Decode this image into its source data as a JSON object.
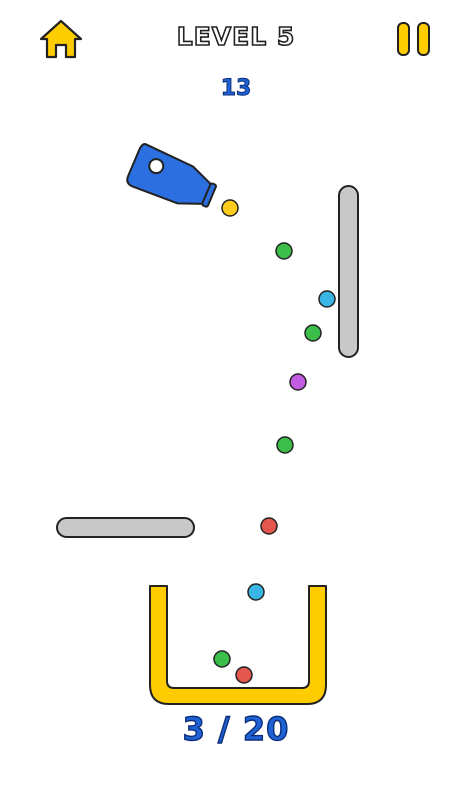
{
  "header": {
    "level_label": "LEVEL 5",
    "score": "13"
  },
  "footer": {
    "progress": "3 / 20"
  },
  "icons": {
    "home": "home-icon",
    "pause": "pause-icon"
  },
  "colors": {
    "ui_yellow": "#ffcc00",
    "cannon_blue": "#2b6fe0",
    "wall_gray": "#c8c8c8",
    "ball_yellow": "#ffcc1a",
    "ball_green": "#3cbf4a",
    "ball_cyan": "#39b6e6",
    "ball_purple": "#c45be3",
    "ball_red": "#e4574c"
  },
  "balls": [
    {
      "color": "yellow"
    },
    {
      "color": "green"
    },
    {
      "color": "cyan"
    },
    {
      "color": "green"
    },
    {
      "color": "purple"
    },
    {
      "color": "green"
    },
    {
      "color": "red"
    },
    {
      "color": "cyan"
    },
    {
      "color": "green"
    },
    {
      "color": "red"
    }
  ]
}
